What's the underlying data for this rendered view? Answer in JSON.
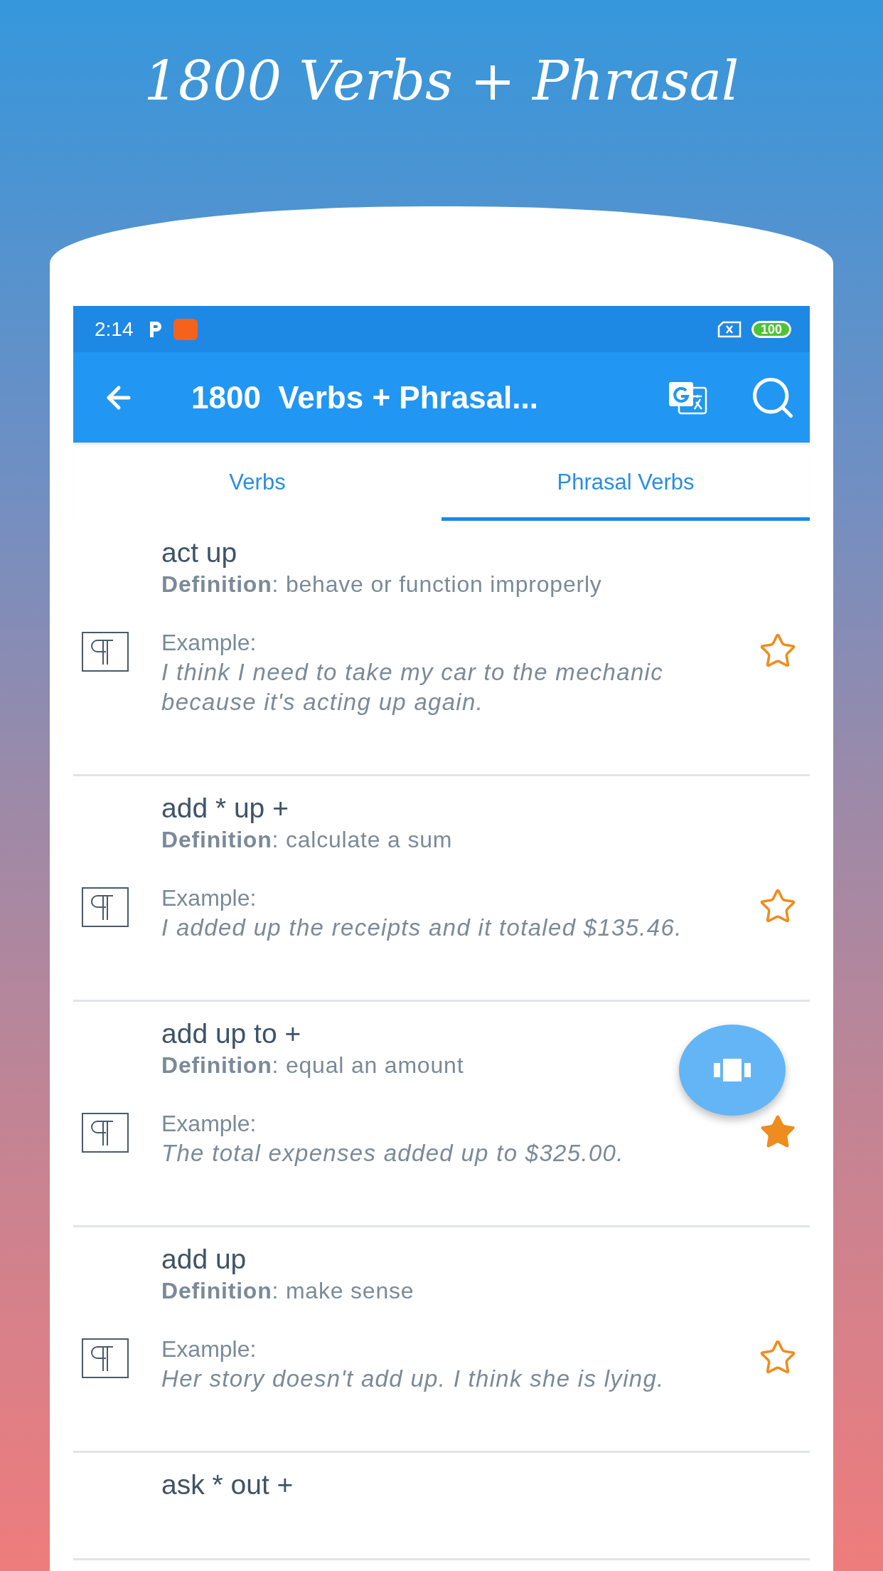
{
  "headline": "1800 Verbs + Phrasal",
  "status_bar": {
    "time": "2:14",
    "battery": "100"
  },
  "app_bar": {
    "title": "1800  Verbs + Phrasal..."
  },
  "tabs": [
    {
      "label": "Verbs",
      "selected": false
    },
    {
      "label": "Phrasal Verbs",
      "selected": true
    }
  ],
  "entries": [
    {
      "phrase": "act up",
      "definition": "**Definition**: behave or function improperly",
      "example_label": "Example:",
      "example": "I think I need to take my car to the mechanic because it's acting up again.",
      "favorite": false
    },
    {
      "phrase": "add * up +",
      "definition": "**Definition**: calculate a sum",
      "example_label": "Example:",
      "example": "I added up the receipts and it totaled $135.46.",
      "favorite": false
    },
    {
      "phrase": "add up to +",
      "definition": "**Definition**: equal an amount",
      "example_label": "Example:",
      "example": "The total expenses added up to $325.00.",
      "favorite": true
    },
    {
      "phrase": "add up",
      "definition": "**Definition**: make sense",
      "example_label": "Example:",
      "example": "Her story doesn't add up. I think she is lying.",
      "favorite": false
    },
    {
      "phrase": "ask * out +"
    }
  ]
}
